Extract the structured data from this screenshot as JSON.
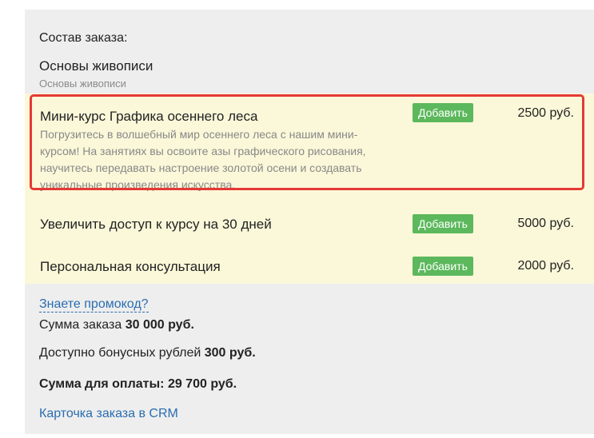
{
  "order": {
    "heading": "Состав заказа:",
    "product_name": "Основы живописи",
    "product_subtitle": "Основы живописи"
  },
  "offers": [
    {
      "title": "Мини-курс Графика осеннего леса",
      "description": "Погрузитесь в волшебный мир осеннего леса с нашим мини-курсом! На занятиях вы освоите азы графического рисования, научитесь передавать настроение золотой осени и создавать уникальные произведения искусства.",
      "button_label": "Добавить",
      "price": "2500 руб."
    },
    {
      "title": "Увеличить доступ к курсу на 30 дней",
      "button_label": "Добавить",
      "price": "5000 руб."
    },
    {
      "title": "Персональная консультация",
      "button_label": "Добавить",
      "price": "2000 руб."
    }
  ],
  "summary": {
    "promo_link": "Знаете промокод?",
    "sum_label": "Сумма заказа",
    "sum_value": "30 000 руб.",
    "bonus_label": "Доступно бонусных рублей",
    "bonus_value": "300 руб.",
    "pay_label": "Сумма для оплаты:",
    "pay_value": "29 700 руб.",
    "crm_link": "Карточка заказа в CRM"
  },
  "colors": {
    "highlight_border": "#e53935",
    "button_bg": "#5cb85c",
    "offers_bg": "#fbf8d9",
    "link": "#2a6db0"
  }
}
